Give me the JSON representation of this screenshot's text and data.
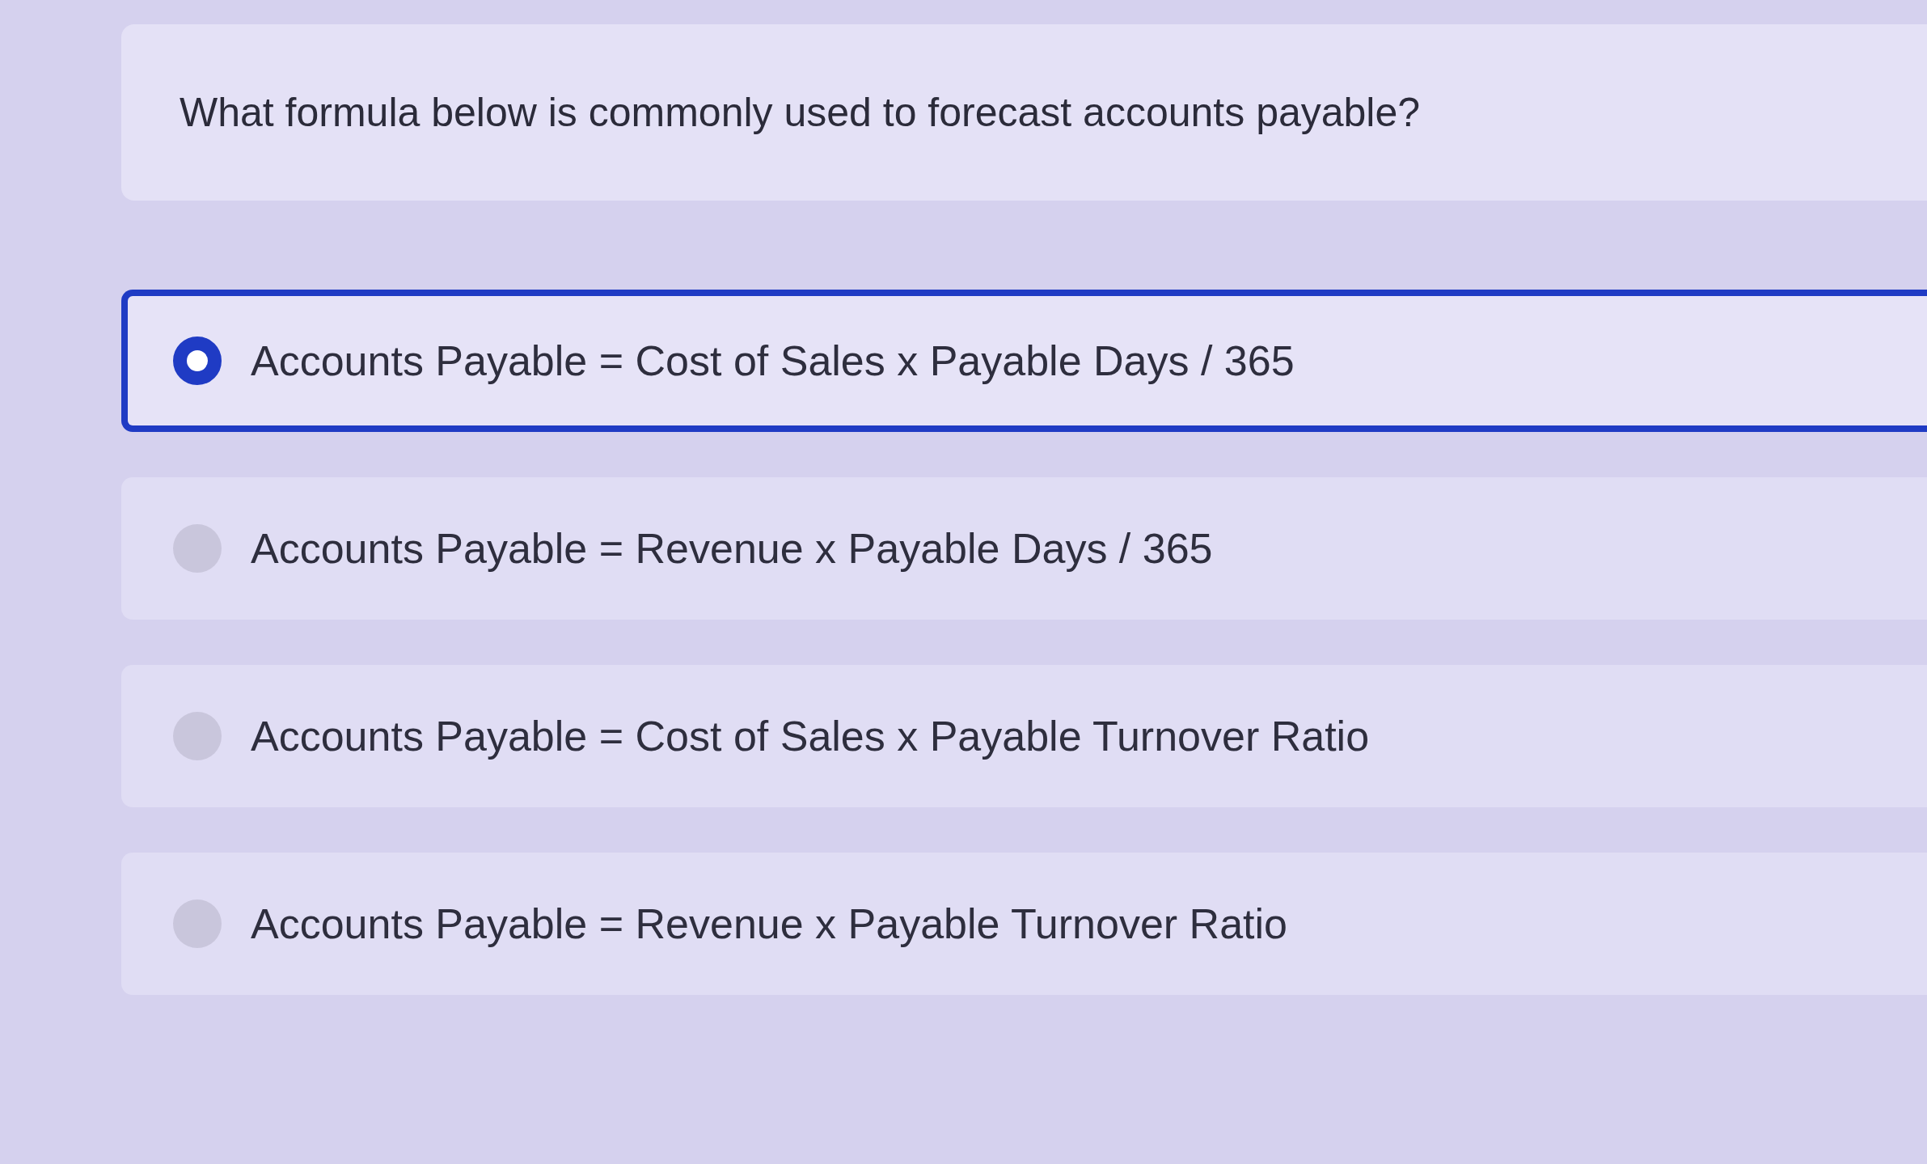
{
  "question": "What formula below is commonly used to forecast accounts payable?",
  "options": [
    {
      "label": "Accounts Payable = Cost of Sales x Payable Days / 365",
      "selected": true
    },
    {
      "label": "Accounts Payable = Revenue x Payable Days / 365",
      "selected": false
    },
    {
      "label": "Accounts Payable = Cost of Sales x Payable Turnover Ratio",
      "selected": false
    },
    {
      "label": "Accounts Payable = Revenue x Payable Turnover Ratio",
      "selected": false
    }
  ]
}
